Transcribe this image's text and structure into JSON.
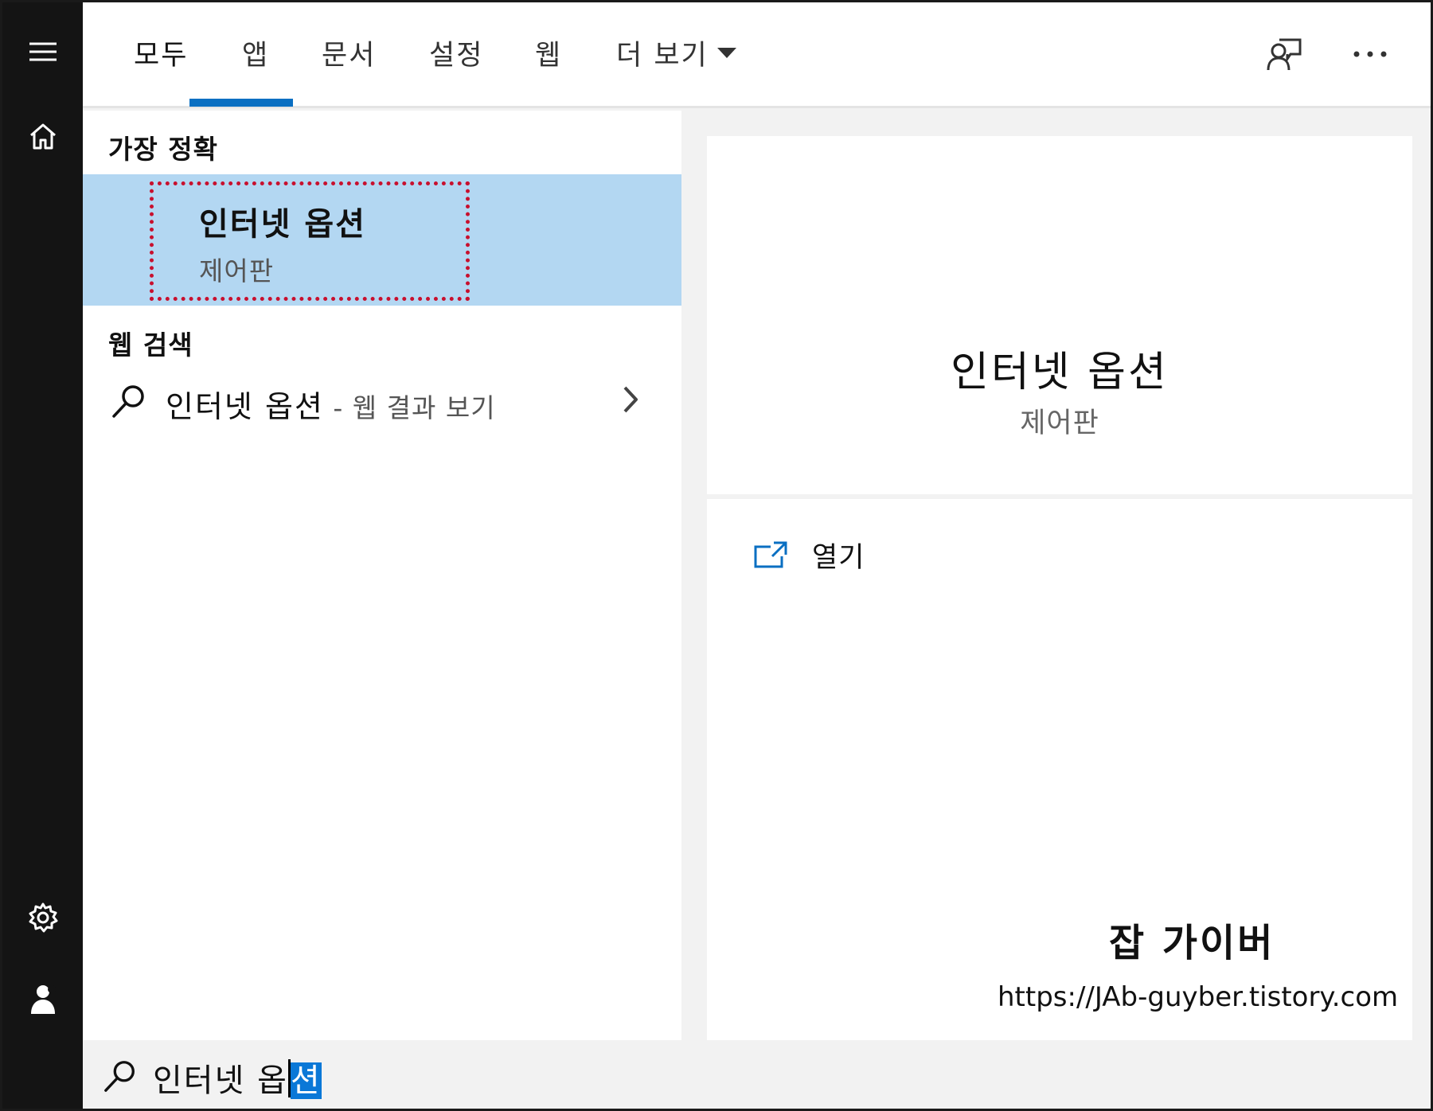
{
  "tabs": [
    {
      "label": "모두"
    },
    {
      "label": "앱"
    },
    {
      "label": "문서"
    },
    {
      "label": "설정"
    },
    {
      "label": "웹"
    },
    {
      "label": "더 보기"
    }
  ],
  "sections": {
    "best_match": "가장 정확",
    "web_search": "웹 검색"
  },
  "best_match": {
    "title": "인터넷 옵션",
    "subtitle": "제어판"
  },
  "web_result": {
    "query": "인터넷 옵션",
    "suffix": " - 웹 결과 보기"
  },
  "preview": {
    "title": "인터넷 옵션",
    "subtitle": "제어판",
    "actions": [
      {
        "label": "열기",
        "icon": "open-icon"
      }
    ]
  },
  "watermark": {
    "title": "잡 가이버",
    "url": "https://JAb-guyber.tistory.com"
  },
  "search": {
    "text_before": "인터넷 옵",
    "text_selected": "션"
  },
  "colors": {
    "accent": "#0a6fc2",
    "selected_row": "#b3d7f2",
    "highlight_border": "#c8102e",
    "rail": "#141414"
  }
}
